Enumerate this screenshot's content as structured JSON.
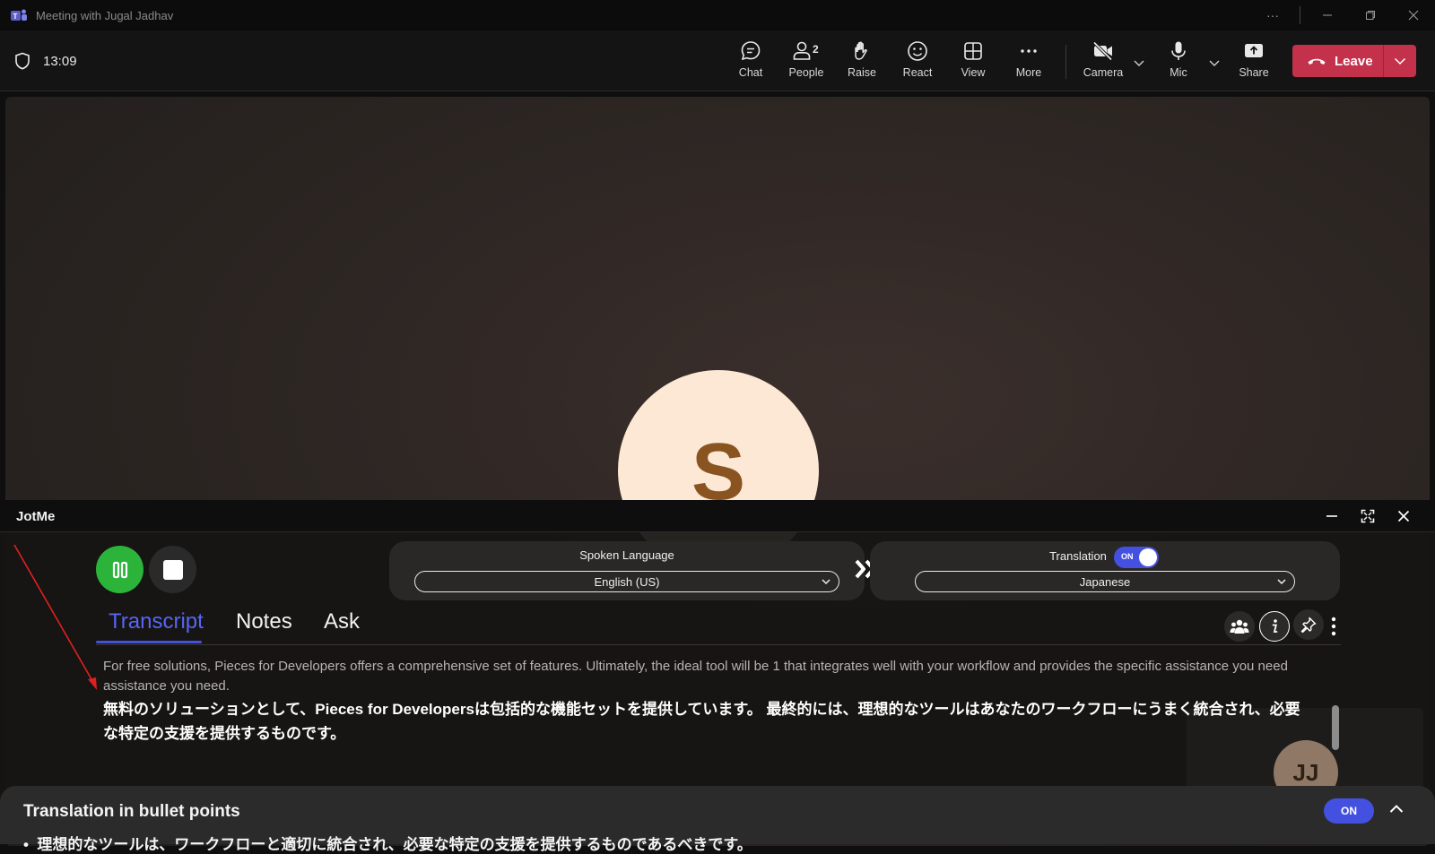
{
  "window": {
    "title": "Meeting with Jugal Jadhav",
    "more_label": "···"
  },
  "toolbar": {
    "timer": "13:09",
    "items": [
      {
        "label": "Chat",
        "icon": "chat-icon"
      },
      {
        "label": "People",
        "icon": "people-icon",
        "badge": "2"
      },
      {
        "label": "Raise",
        "icon": "raise-hand-icon"
      },
      {
        "label": "React",
        "icon": "react-icon"
      },
      {
        "label": "View",
        "icon": "view-grid-icon"
      },
      {
        "label": "More",
        "icon": "more-icon"
      },
      {
        "label": "Camera",
        "icon": "camera-off-icon"
      },
      {
        "label": "Mic",
        "icon": "mic-icon"
      },
      {
        "label": "Share",
        "icon": "share-icon"
      }
    ],
    "leave_label": "Leave"
  },
  "stage": {
    "participant_initial": "S"
  },
  "jotme": {
    "title": "JotMe",
    "spoken_language_label": "Spoken Language",
    "spoken_language_value": "English (US)",
    "translation_label": "Translation",
    "translation_toggle": "ON",
    "translation_language_value": "Japanese",
    "tabs": [
      {
        "label": "Transcript",
        "active": true
      },
      {
        "label": "Notes",
        "active": false
      },
      {
        "label": "Ask",
        "active": false
      }
    ],
    "transcript_original": "For free solutions, Pieces for Developers offers a comprehensive set of features. Ultimately, the ideal tool will be 1 that integrates well with your workflow and provides the specific assistance you need assistance you need.",
    "transcript_translated": "無料のソリューションとして、Pieces for Developersは包括的な機能セットを提供しています。 最終的には、理想的なツールはあなたのワークフローにうまく統合され、必要な特定の支援を提供するものです。",
    "self_view_initials": "JJ",
    "bullets_title": "Translation in bullet points",
    "bullets_toggle": "ON",
    "bullet_1": "理想的なツールは、ワークフローと適切に統合され、必要な特定の支援を提供するものであるべきです。"
  },
  "colors": {
    "accent": "#4451e0",
    "leave": "#c4314b",
    "record": "#2bb33a",
    "annotation_arrow": "#e02020"
  }
}
